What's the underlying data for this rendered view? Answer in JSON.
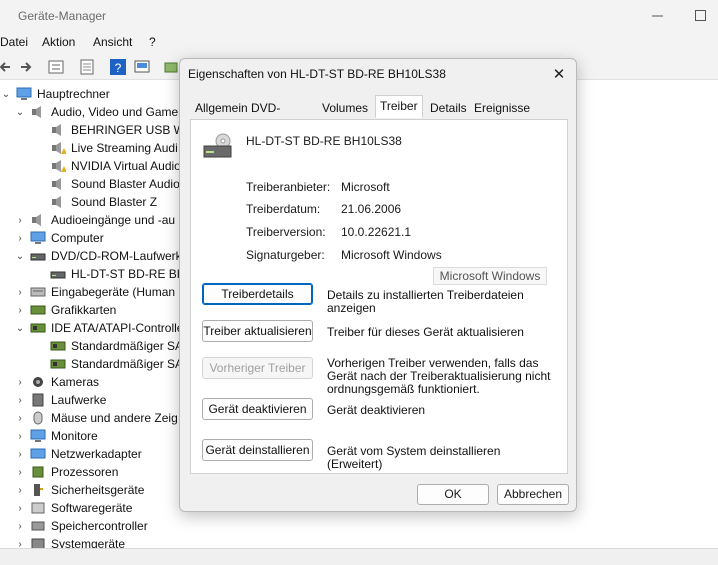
{
  "window": {
    "title": "Geräte-Manager",
    "menu": [
      "Datei",
      "Aktion",
      "Ansicht",
      "?"
    ]
  },
  "tree": {
    "root": "Hauptrechner",
    "rows": [
      {
        "label": "Audio, Video und Game",
        "expanded": true,
        "icon": "speaker-icon"
      },
      {
        "label": "BEHRINGER USB WD",
        "icon": "speaker-icon"
      },
      {
        "label": "Live Streaming Audi",
        "icon": "speaker-warning-icon"
      },
      {
        "label": "NVIDIA Virtual Audio",
        "icon": "speaker-warning-icon"
      },
      {
        "label": "Sound Blaster Audio",
        "icon": "speaker-icon"
      },
      {
        "label": "Sound Blaster Z",
        "icon": "speaker-icon"
      },
      {
        "label": "Audioeingänge und -au",
        "expanded": false,
        "icon": "speaker-icon"
      },
      {
        "label": "Computer",
        "expanded": false,
        "icon": "monitor-icon"
      },
      {
        "label": "DVD/CD-ROM-Laufwerk",
        "expanded": true,
        "icon": "disc-drive-icon"
      },
      {
        "label": "HL-DT-ST BD-RE  BH",
        "icon": "disc-drive-icon"
      },
      {
        "label": "Eingabegeräte (Human",
        "expanded": false,
        "icon": "keyboard-icon"
      },
      {
        "label": "Grafikkarten",
        "expanded": false,
        "icon": "graphics-card-icon"
      },
      {
        "label": "IDE ATA/ATAPI-Controlle",
        "expanded": true,
        "icon": "controller-icon"
      },
      {
        "label": "Standardmäßiger SA",
        "icon": "controller-icon"
      },
      {
        "label": "Standardmäßiger SA",
        "icon": "controller-icon"
      },
      {
        "label": "Kameras",
        "expanded": false,
        "icon": "camera-icon"
      },
      {
        "label": "Laufwerke",
        "expanded": false,
        "icon": "drive-icon"
      },
      {
        "label": "Mäuse und andere Zeig",
        "expanded": false,
        "icon": "mouse-icon"
      },
      {
        "label": "Monitore",
        "expanded": false,
        "icon": "monitor-icon"
      },
      {
        "label": "Netzwerkadapter",
        "expanded": false,
        "icon": "network-icon"
      },
      {
        "label": "Prozessoren",
        "expanded": false,
        "icon": "cpu-icon"
      },
      {
        "label": "Sicherheitsgeräte",
        "expanded": false,
        "icon": "security-icon"
      },
      {
        "label": "Softwaregeräte",
        "expanded": false,
        "icon": "software-icon"
      },
      {
        "label": "Speichercontroller",
        "expanded": false,
        "icon": "storage-icon"
      },
      {
        "label": "Systemgeräte",
        "expanded": false,
        "icon": "system-icon"
      }
    ]
  },
  "dialog": {
    "title": "Eigenschaften von HL-DT-ST BD-RE  BH10LS38",
    "tabs": [
      "Allgemein",
      "DVD-Region",
      "Volumes",
      "Treiber",
      "Details",
      "Ereignisse"
    ],
    "active_tab": "Treiber",
    "device_name": "HL-DT-ST BD-RE  BH10LS38",
    "properties": {
      "provider_label": "Treiberanbieter:",
      "provider_value": "Microsoft",
      "date_label": "Treiberdatum:",
      "date_value": "21.06.2006",
      "version_label": "Treiberversion:",
      "version_value": "10.0.22621.1",
      "signer_label": "Signaturgeber:",
      "signer_value": "Microsoft Windows"
    },
    "signer_box": "Microsoft Windows",
    "actions": [
      {
        "button": "Treiberdetails",
        "desc": "Details zu installierten Treiberdateien anzeigen"
      },
      {
        "button": "Treiber aktualisieren",
        "desc": "Treiber für dieses Gerät aktualisieren"
      },
      {
        "button": "Vorheriger Treiber",
        "desc": "Vorherigen Treiber verwenden, falls das Gerät nach der Treiberaktualisierung nicht ordnungsgemäß funktioniert."
      },
      {
        "button": "Gerät deaktivieren",
        "desc": "Gerät deaktivieren"
      },
      {
        "button": "Gerät deinstallieren",
        "desc": "Gerät vom System deinstallieren (Erweitert)"
      }
    ],
    "ok": "OK",
    "cancel": "Abbrechen"
  }
}
